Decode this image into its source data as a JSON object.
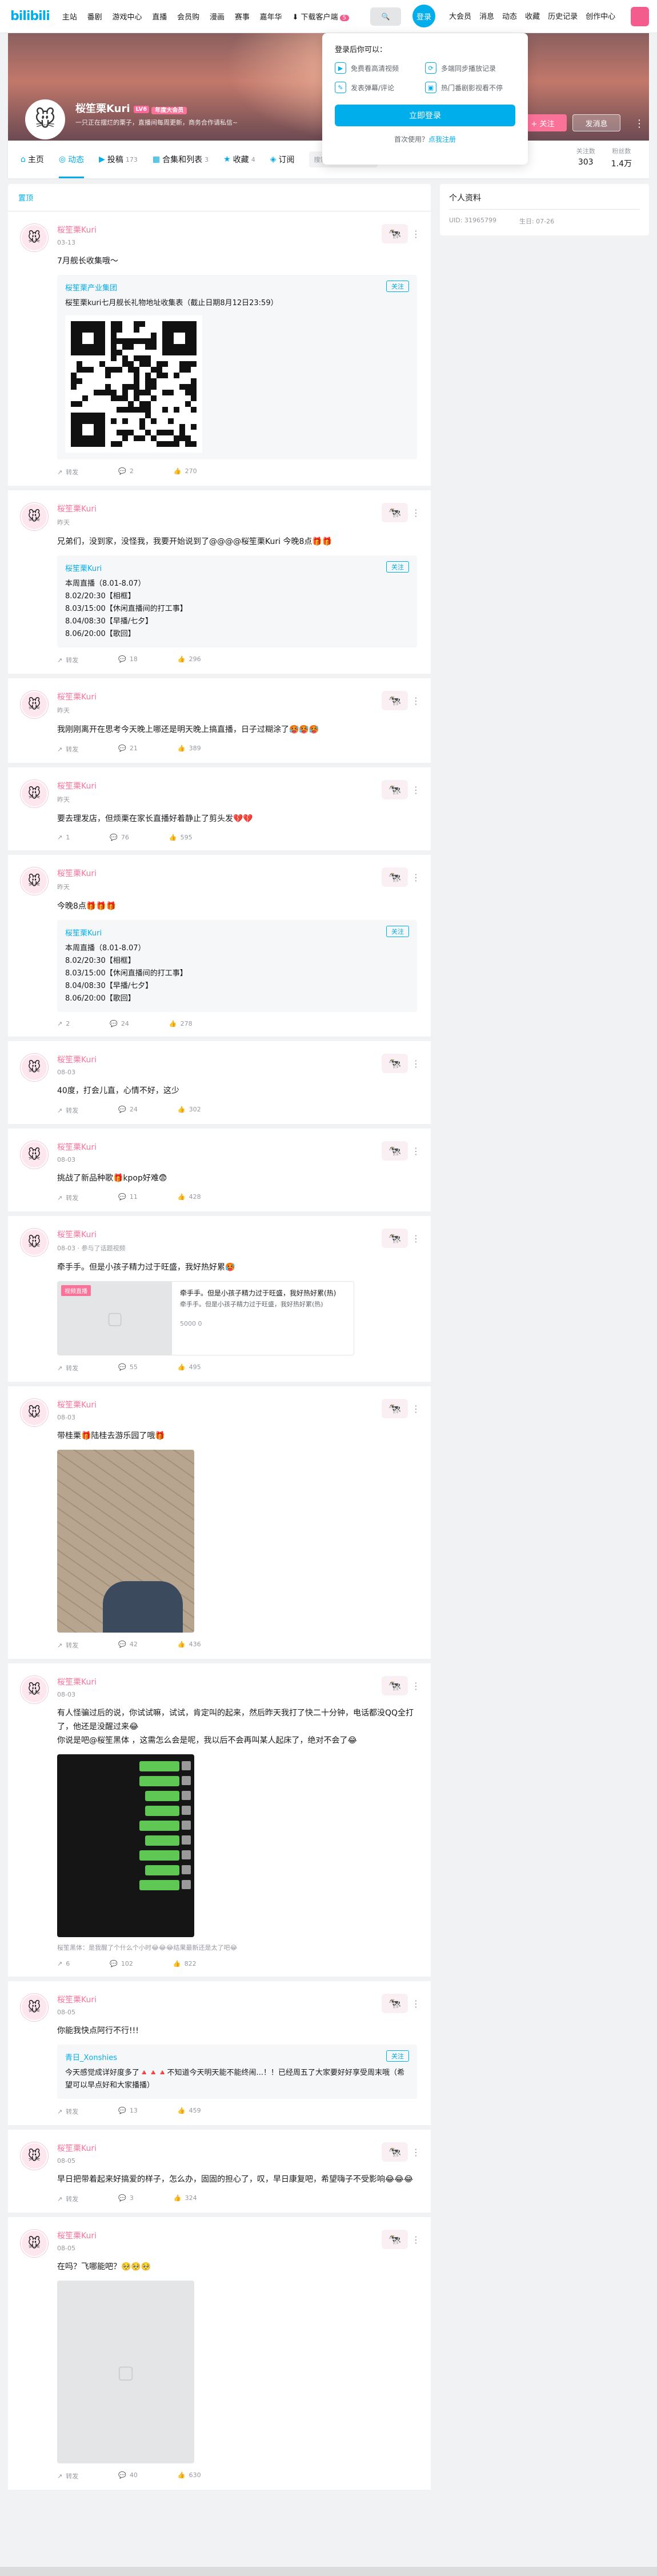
{
  "header": {
    "logo": "bilibili",
    "nav": [
      "主站",
      "番剧",
      "游戏中心",
      "直播",
      "会员购",
      "漫画",
      "赛事",
      "嘉年华"
    ],
    "download": "下载客户端",
    "download_badge": "5",
    "login": "登录",
    "right": [
      "大会员",
      "消息",
      "动态",
      "收藏",
      "历史记录",
      "创作中心"
    ]
  },
  "profile": {
    "name": "桜笙栗Kuri",
    "level": "LV6",
    "tag": "年度大会员",
    "sign": "一只正在摆烂的栗子，直播间每周更新，商务合作请私信~",
    "follow_btn": "+ 关注",
    "msg_btn": "发消息"
  },
  "tabs": [
    {
      "icon": "⌂",
      "label": "主页",
      "count": ""
    },
    {
      "icon": "◎",
      "label": "动态",
      "count": ""
    },
    {
      "icon": "▶",
      "label": "投稿",
      "count": "173"
    },
    {
      "icon": "▦",
      "label": "合集和列表",
      "count": "3"
    },
    {
      "icon": "★",
      "label": "收藏",
      "count": "4"
    },
    {
      "icon": "◈",
      "label": "订阅",
      "count": ""
    }
  ],
  "tab_search_placeholder": "搜索视频、动态",
  "stats": [
    {
      "label": "关注数",
      "value": "303"
    },
    {
      "label": "粉丝数",
      "value": "1.4万"
    }
  ],
  "popup": {
    "title": "登录后你可以：",
    "features": [
      "免费看高清视频",
      "多端同步播放记录",
      "发表弹幕/评论",
      "热门番剧影视看不停"
    ],
    "login_btn": "立即登录",
    "register_prompt": "首次使用？",
    "register_link": "点我注册"
  },
  "main_head": "置顶",
  "sidebar": {
    "title": "个人资料",
    "uid": "UID: 31965799",
    "birthday": "生日: 07-26"
  },
  "posts": [
    {
      "name": "桜笙栗Kuri",
      "time": "03-13",
      "text": "7月舰长收集哦～",
      "card": {
        "user": "桜笙栗产业集团",
        "chip": "关注",
        "text": "桜笙栗kuri七月舰长礼物地址收集表（截止日期8月12日23:59）"
      },
      "tools": [
        "转发",
        "2",
        "270"
      ]
    },
    {
      "name": "桜笙栗Kuri",
      "time": "昨天",
      "text": "兄弟们，没到家，没怪我，我要开始说到了@@@@桜笙栗Kuri 今晚8点🎁🎁",
      "card": {
        "user": "桜笙栗Kuri",
        "chip": "关注",
        "text": "本周直播（8.01-8.07）\n8.02/20:30【相框】\n8.03/15:00【休闲直播间的打工事】\n8.04/08:30【早播/七夕】\n8.06/20:00【歌回】"
      },
      "tools": [
        "转发",
        "18",
        "296"
      ]
    },
    {
      "name": "桜笙栗Kuri",
      "time": "昨天",
      "text": "我刚刚离开在思考今天晚上哪还是明天晚上搞直播，日子过糊涂了🥵🥵🥵",
      "tools": [
        "转发",
        "21",
        "389"
      ]
    },
    {
      "name": "桜笙栗Kuri",
      "time": "昨天",
      "text": "要去理发店，但烦栗在家长直播好着静止了剪头发💔💔",
      "tools": [
        "1",
        "76",
        "595"
      ]
    },
    {
      "name": "桜笙栗Kuri",
      "time": "昨天",
      "text": "今晚8点🎁🎁🎁",
      "card": {
        "user": "桜笙栗Kuri",
        "chip": "关注",
        "text": "本周直播（8.01-8.07）\n8.02/20:30【相框】\n8.03/15:00【休闲直播间的打工事】\n8.04/08:30【早播/七夕】\n8.06/20:00【歌回】"
      },
      "tools": [
        "2",
        "24",
        "278"
      ]
    },
    {
      "name": "桜笙栗Kuri",
      "time": "08-03",
      "text": "40度，打会儿直，心情不好，这少",
      "tools": [
        "转发",
        "24",
        "302"
      ]
    },
    {
      "name": "桜笙栗Kuri",
      "time": "08-03",
      "text": "挑战了新品种歌🎁kpop好难😨",
      "tools": [
        "转发",
        "11",
        "428"
      ]
    },
    {
      "name": "桜笙栗Kuri",
      "time": "08-03 · 参与了话题视频",
      "text": "牵手手。但是小孩子精力过于旺盛，我好热好累🥵",
      "hashtag": {
        "label": "视频直播",
        "title": "牵手手。但是小孩子精力过于旺盛，我好热好累(热)",
        "sub": "牵手手。但是小孩子精力过于旺盛，我好热好累(热)",
        "meta": "5000    0"
      },
      "tools": [
        "转发",
        "55",
        "495"
      ]
    },
    {
      "name": "桜笙栗Kuri",
      "time": "08-03",
      "text": "带桂栗🎁陆桂去游乐园了哦🎁",
      "tools": [
        "转发",
        "42",
        "436"
      ]
    },
    {
      "name": "桜笙栗Kuri",
      "time": "08-03",
      "text": "有人怪骗过后的说，你试试嘛，试试，肯定叫的起来，然后昨天我打了快二十分钟，电话都没QQ全打了，他还是没醒过来😂\n你说是吧@桜笙黑体 ，这需怎么会是呢，我以后不会再叫某人起床了，绝对不会了😂",
      "comment": "桜笙黑体：是我醒了个什么个小时😂😂😂结果最新还是太了吧😂",
      "tools": [
        "6",
        "102",
        "822"
      ]
    },
    {
      "name": "桜笙栗Kuri",
      "time": "08-05",
      "text": "你能我快点阿行不行!!!",
      "card": {
        "user": "青日_Xonshies",
        "chip": "关注",
        "text": "今天感觉成详好度多了🔺🔺🔺不知道今天明天能不能终闹...！！已经周五了大家要好好享受周末哦（希望可以早点好和大家播播）"
      },
      "tools": [
        "转发",
        "13",
        "459"
      ]
    },
    {
      "name": "桜笙栗Kuri",
      "time": "08-05",
      "text": "早日把带着起来好搞爱的样子，怎么办，固固的担心了，叹，早日康复吧，希望嗨子不受影响😂😂😂",
      "tools": [
        "转发",
        "3",
        "324"
      ]
    },
    {
      "name": "桜笙栗Kuri",
      "time": "08-05",
      "text": "在吗？飞哪能吧？🥺🥺🥺",
      "tools": [
        "转发",
        "40",
        "630"
      ]
    }
  ],
  "colors": {
    "accent": "#00aeec",
    "pink": "#fb7299"
  }
}
